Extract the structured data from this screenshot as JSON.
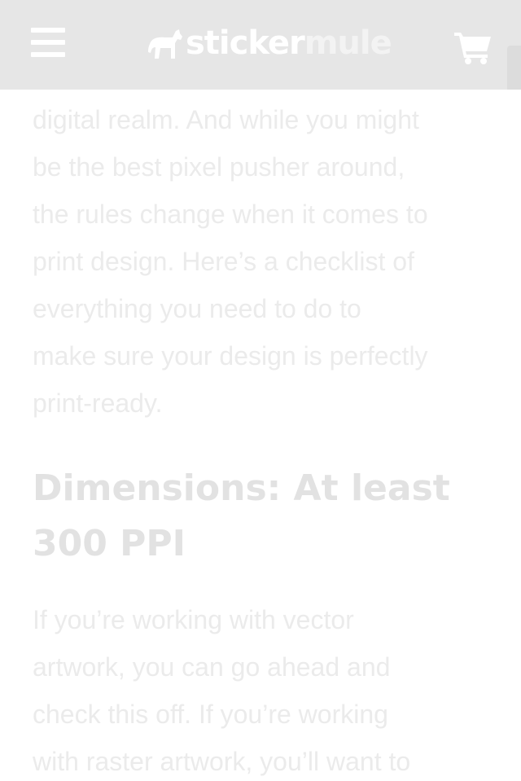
{
  "header": {
    "logo_text_primary": "sticker",
    "logo_text_secondary": "mule",
    "menu_icon": "hamburger-menu-icon",
    "cart_icon": "shopping-cart-icon",
    "background_color": "#e6e6e6"
  },
  "article": {
    "paragraph_1_lines": [
      "digital realm. And while you might",
      "be the best pixel pusher around,",
      "the rules change when it comes to",
      "print design. Here’s a checklist of",
      "everything you need to do to",
      "make sure your design is perfectly",
      "print-ready."
    ],
    "heading_lines": [
      "Dimensions: At least",
      "300 PPI"
    ],
    "paragraph_2_lines": [
      "If you’re working with vector",
      "artwork, you can go ahead and",
      "check this off. If you’re working",
      "with raster artwork, you’ll want to"
    ]
  }
}
